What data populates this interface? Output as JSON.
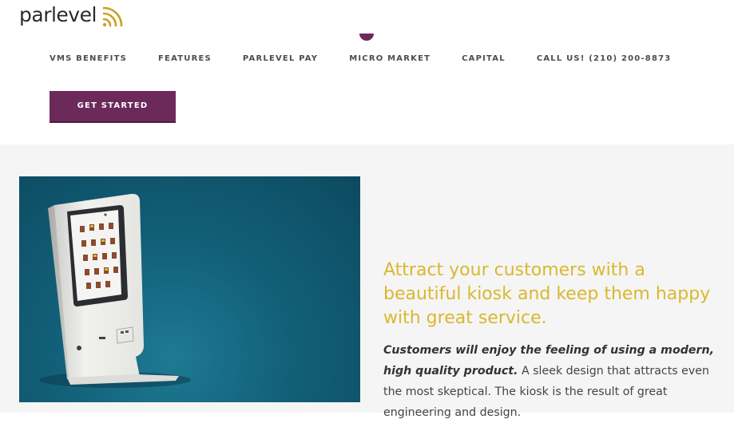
{
  "brand": {
    "logo_text": "parlevel",
    "logo_color": "#c9a227",
    "primary_color": "#6c2a5b",
    "icon": "wifi-signal-icon"
  },
  "nav": {
    "items": [
      {
        "label": "VMS BENEFITS"
      },
      {
        "label": "FEATURES"
      },
      {
        "label": "PARLEVEL PAY"
      },
      {
        "label": "MICRO MARKET"
      },
      {
        "label": "CAPITAL"
      },
      {
        "label": "CALL US! (210) 200-8873"
      }
    ],
    "cta_label": "GET STARTED"
  },
  "feature": {
    "image_subject": "self-checkout kiosk",
    "headline": "Attract your customers with a beautiful kiosk and keep them happy with great service.",
    "body_emphasis": "Customers will enjoy the feeling of using a modern, high quality product.",
    "body_rest": "A sleek design that attracts even the most skeptical. The kiosk is the result of great engineering and design."
  }
}
